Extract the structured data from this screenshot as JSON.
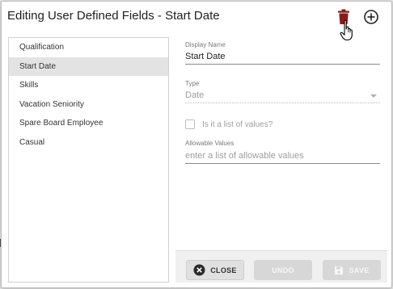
{
  "dialog": {
    "title": "Editing User Defined Fields - Start Date"
  },
  "list": {
    "items": [
      {
        "label": "Qualification",
        "selected": false
      },
      {
        "label": "Start Date",
        "selected": true
      },
      {
        "label": "Skills",
        "selected": false
      },
      {
        "label": "Vacation Seniority",
        "selected": false
      },
      {
        "label": "Spare Board Employee",
        "selected": false
      },
      {
        "label": "Casual",
        "selected": false
      }
    ]
  },
  "form": {
    "display_name_label": "Display Name",
    "display_name_value": "Start Date",
    "type_label": "Type",
    "type_value": "Date",
    "list_checkbox_label": "Is it a list of values?",
    "list_checkbox_checked": false,
    "allowable_label": "Allowable Values",
    "allowable_placeholder": "enter a list of allowable values"
  },
  "footer": {
    "close_label": "CLOSE",
    "undo_label": "UNDO",
    "save_label": "SAVE"
  },
  "colors": {
    "trash_icon": "#8b1a1a",
    "selected_row": "#e3e3e3",
    "disabled_button": "#d7d7d7"
  },
  "icons": [
    "trash-icon",
    "add-circle-icon",
    "hand-pointer-icon",
    "close-circle-icon",
    "save-icon",
    "dropdown-caret-icon"
  ]
}
